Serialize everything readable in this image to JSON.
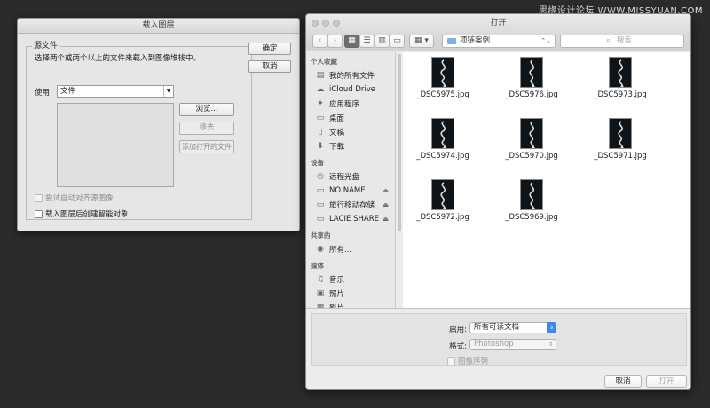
{
  "watermark": "思缘设计论坛 WWW.MISSYUAN.COM",
  "load_layers": {
    "title": "载入图层",
    "group_title": "源文件",
    "description": "选择两个或两个以上的文件来载入到图像堆栈中。",
    "use_label": "使用:",
    "use_value": "文件",
    "browse_label": "浏览...",
    "remove_label": "移去",
    "add_open_label": "添加打开的文件",
    "ok_label": "确定",
    "cancel_label": "取消",
    "align_label": "尝试自动对齐源图像",
    "smart_object_label": "载入图层后创建智能对象"
  },
  "open_dialog": {
    "title": "打开",
    "toolbar": {
      "back": "‹",
      "forward": "›",
      "view_icons": "▦",
      "view_list": "☰",
      "view_columns": "▥",
      "view_coverflow": "▭",
      "arrange": "▦ ▾",
      "location": "项链案例",
      "location_arrows": "⌃⌄",
      "search_placeholder": "搜索"
    },
    "sidebar": {
      "favorites_title": "个人收藏",
      "favorites": [
        {
          "label": "我的所有文件",
          "icon": "all-files-icon"
        },
        {
          "label": "iCloud Drive",
          "icon": "cloud-icon"
        },
        {
          "label": "应用程序",
          "icon": "applications-icon"
        },
        {
          "label": "桌面",
          "icon": "desktop-icon"
        },
        {
          "label": "文稿",
          "icon": "documents-icon"
        },
        {
          "label": "下载",
          "icon": "downloads-icon"
        }
      ],
      "devices_title": "设备",
      "devices": [
        {
          "label": "远程光盘",
          "icon": "disc-icon"
        },
        {
          "label": "NO NAME",
          "icon": "drive-icon",
          "eject": "⏏"
        },
        {
          "label": "旅行移动存储",
          "icon": "drive-icon",
          "eject": "⏏"
        },
        {
          "label": "LACIE SHARE",
          "icon": "drive-icon",
          "eject": "⏏"
        }
      ],
      "shared_title": "共享的",
      "shared": [
        {
          "label": "所有...",
          "icon": "network-icon"
        }
      ],
      "media_title": "媒体",
      "media": [
        {
          "label": "音乐",
          "icon": "music-icon"
        },
        {
          "label": "照片",
          "icon": "photos-icon"
        },
        {
          "label": "影片",
          "icon": "movies-icon"
        }
      ]
    },
    "files": [
      "_DSC5975.jpg",
      "_DSC5976.jpg",
      "_DSC5973.jpg",
      "_DSC5974.jpg",
      "_DSC5970.jpg",
      "_DSC5971.jpg",
      "_DSC5972.jpg",
      "_DSC5969.jpg"
    ],
    "enable_label": "启用:",
    "enable_value": "所有可读文档",
    "format_label": "格式:",
    "format_value": "Photoshop",
    "sequence_label": "图像序列",
    "cancel_label": "取消",
    "open_label": "打开",
    "accent_color": "#3d86f0"
  }
}
